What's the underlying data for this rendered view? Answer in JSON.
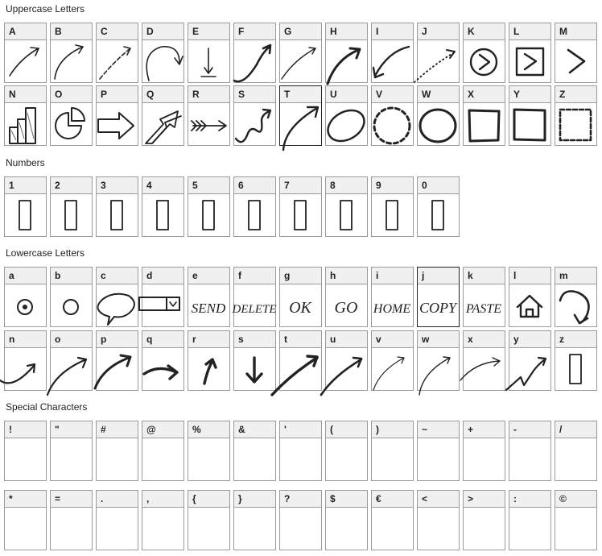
{
  "sections": {
    "uppercase": "Uppercase Letters",
    "numbers": "Numbers",
    "lowercase": "Lowercase Letters",
    "special": "Special Characters"
  },
  "uppercase_row1": [
    "A",
    "B",
    "C",
    "D",
    "E",
    "F",
    "G",
    "H",
    "I",
    "J",
    "K",
    "L",
    "M"
  ],
  "uppercase_row2": [
    "N",
    "O",
    "P",
    "Q",
    "R",
    "S",
    "T",
    "U",
    "V",
    "W",
    "X",
    "Y",
    "Z"
  ],
  "numbers": [
    "1",
    "2",
    "3",
    "4",
    "5",
    "6",
    "7",
    "8",
    "9",
    "0"
  ],
  "lowercase_row1": [
    "a",
    "b",
    "c",
    "d",
    "e",
    "f",
    "g",
    "h",
    "i",
    "j",
    "k",
    "l",
    "m"
  ],
  "lowercase_row2": [
    "n",
    "o",
    "p",
    "q",
    "r",
    "s",
    "t",
    "u",
    "v",
    "w",
    "x",
    "y",
    "z"
  ],
  "special_row1": [
    "!",
    "\"",
    "#",
    "@",
    "%",
    "&",
    "'",
    "(",
    ")",
    "~",
    "+",
    "-",
    "/"
  ],
  "special_row2": [
    "*",
    "=",
    ".",
    ",",
    "{",
    "}",
    "?",
    "$",
    "€",
    "<",
    ">",
    ":",
    "©"
  ],
  "glyph_words": {
    "e": "SEND",
    "f": "DELETE",
    "g": "OK",
    "h": "GO",
    "i": "HOME",
    "j": "COPY",
    "k": "PASTE"
  },
  "icons": {
    "A": "arrow-up-right-icon",
    "B": "arrow-curve-right-icon",
    "C": "dashed-arrow-icon",
    "D": "arc-arrow-icon",
    "E": "arrow-down-to-line-icon",
    "F": "swoosh-arrow-icon",
    "G": "arrow-up-right-icon",
    "H": "bold-arrow-icon",
    "I": "curved-left-arrow-icon",
    "J": "dotted-arrow-icon",
    "K": "circle-chevron-icon",
    "L": "square-chevron-icon",
    "M": "chevron-right-icon",
    "N": "bar-chart-icon",
    "O": "pie-chart-icon",
    "P": "block-arrow-icon",
    "Q": "double-block-arrow-icon",
    "R": "feather-arrow-icon",
    "S": "squiggle-arrow-icon",
    "T": "big-arrow-icon",
    "U": "ellipse-icon",
    "V": "dashed-circle-icon",
    "W": "circle-icon",
    "X": "square-icon",
    "Y": "square-icon",
    "Z": "dashed-square-icon",
    "a": "target-icon",
    "b": "ring-icon",
    "c": "speech-bubble-icon",
    "d": "dropdown-box-icon",
    "l": "home-icon",
    "m": "curl-arrow-icon"
  }
}
